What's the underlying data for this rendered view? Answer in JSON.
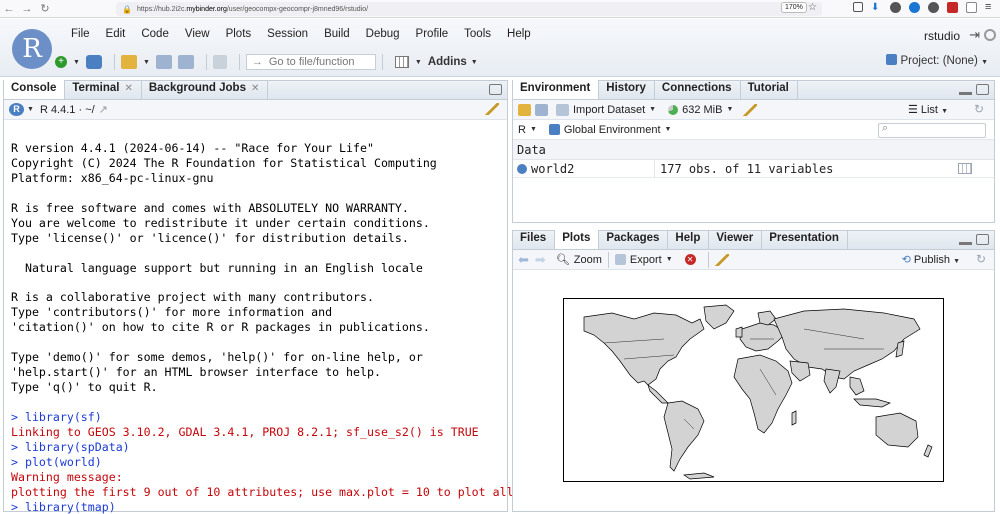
{
  "browser": {
    "url_prefix": "https://hub.2i2c.",
    "url_host": "mybinder.org",
    "url_path": "/user/geocompx-geocompr-j8mned96/rstudio/",
    "zoom": "170%"
  },
  "menu": [
    "File",
    "Edit",
    "Code",
    "View",
    "Plots",
    "Session",
    "Build",
    "Debug",
    "Profile",
    "Tools",
    "Help"
  ],
  "header": {
    "user": "rstudio",
    "goto_placeholder": "Go to file/function",
    "addins": "Addins",
    "project": "Project: (None)"
  },
  "console_pane": {
    "tabs": [
      "Console",
      "Terminal",
      "Background Jobs"
    ],
    "r_version": "R 4.4.1",
    "path": "~/",
    "lines": [
      {
        "t": "",
        "k": "out"
      },
      {
        "t": "R version 4.4.1 (2024-06-14) -- \"Race for Your Life\"",
        "k": "out"
      },
      {
        "t": "Copyright (C) 2024 The R Foundation for Statistical Computing",
        "k": "out"
      },
      {
        "t": "Platform: x86_64-pc-linux-gnu",
        "k": "out"
      },
      {
        "t": "",
        "k": "out"
      },
      {
        "t": "R is free software and comes with ABSOLUTELY NO WARRANTY.",
        "k": "out"
      },
      {
        "t": "You are welcome to redistribute it under certain conditions.",
        "k": "out"
      },
      {
        "t": "Type 'license()' or 'licence()' for distribution details.",
        "k": "out"
      },
      {
        "t": "",
        "k": "out"
      },
      {
        "t": "  Natural language support but running in an English locale",
        "k": "out"
      },
      {
        "t": "",
        "k": "out"
      },
      {
        "t": "R is a collaborative project with many contributors.",
        "k": "out"
      },
      {
        "t": "Type 'contributors()' for more information and",
        "k": "out"
      },
      {
        "t": "'citation()' on how to cite R or R packages in publications.",
        "k": "out"
      },
      {
        "t": "",
        "k": "out"
      },
      {
        "t": "Type 'demo()' for some demos, 'help()' for on-line help, or",
        "k": "out"
      },
      {
        "t": "'help.start()' for an HTML browser interface to help.",
        "k": "out"
      },
      {
        "t": "Type 'q()' to quit R.",
        "k": "out"
      },
      {
        "t": "",
        "k": "out"
      },
      {
        "t": "> library(sf)",
        "k": "cmd"
      },
      {
        "t": "Linking to GEOS 3.10.2, GDAL 3.4.1, PROJ 8.2.1; sf_use_s2() is TRUE",
        "k": "err"
      },
      {
        "t": "> library(spData)",
        "k": "cmd"
      },
      {
        "t": "> plot(world)",
        "k": "cmd"
      },
      {
        "t": "Warning message:",
        "k": "err"
      },
      {
        "t": "plotting the first 9 out of 10 attributes; use max.plot = 10 to plot all",
        "k": "err"
      },
      {
        "t": "> library(tmap)",
        "k": "cmd"
      }
    ]
  },
  "env_pane": {
    "tabs": [
      "Environment",
      "History",
      "Connections",
      "Tutorial"
    ],
    "import_dataset": "Import Dataset",
    "memory": "632 MiB",
    "list_label": "List",
    "r_label": "R",
    "global_env": "Global Environment",
    "data_header": "Data",
    "rows": [
      {
        "name": "world2",
        "value": "177 obs. of 11 variables"
      }
    ]
  },
  "files_pane": {
    "tabs": [
      "Files",
      "Plots",
      "Packages",
      "Help",
      "Viewer",
      "Presentation"
    ],
    "zoom_label": "Zoom",
    "export_label": "Export",
    "publish_label": "Publish"
  },
  "colors": {
    "accent": "#4a7fc1",
    "error_text": "#c5060b",
    "command_text": "#1c3bd6"
  }
}
